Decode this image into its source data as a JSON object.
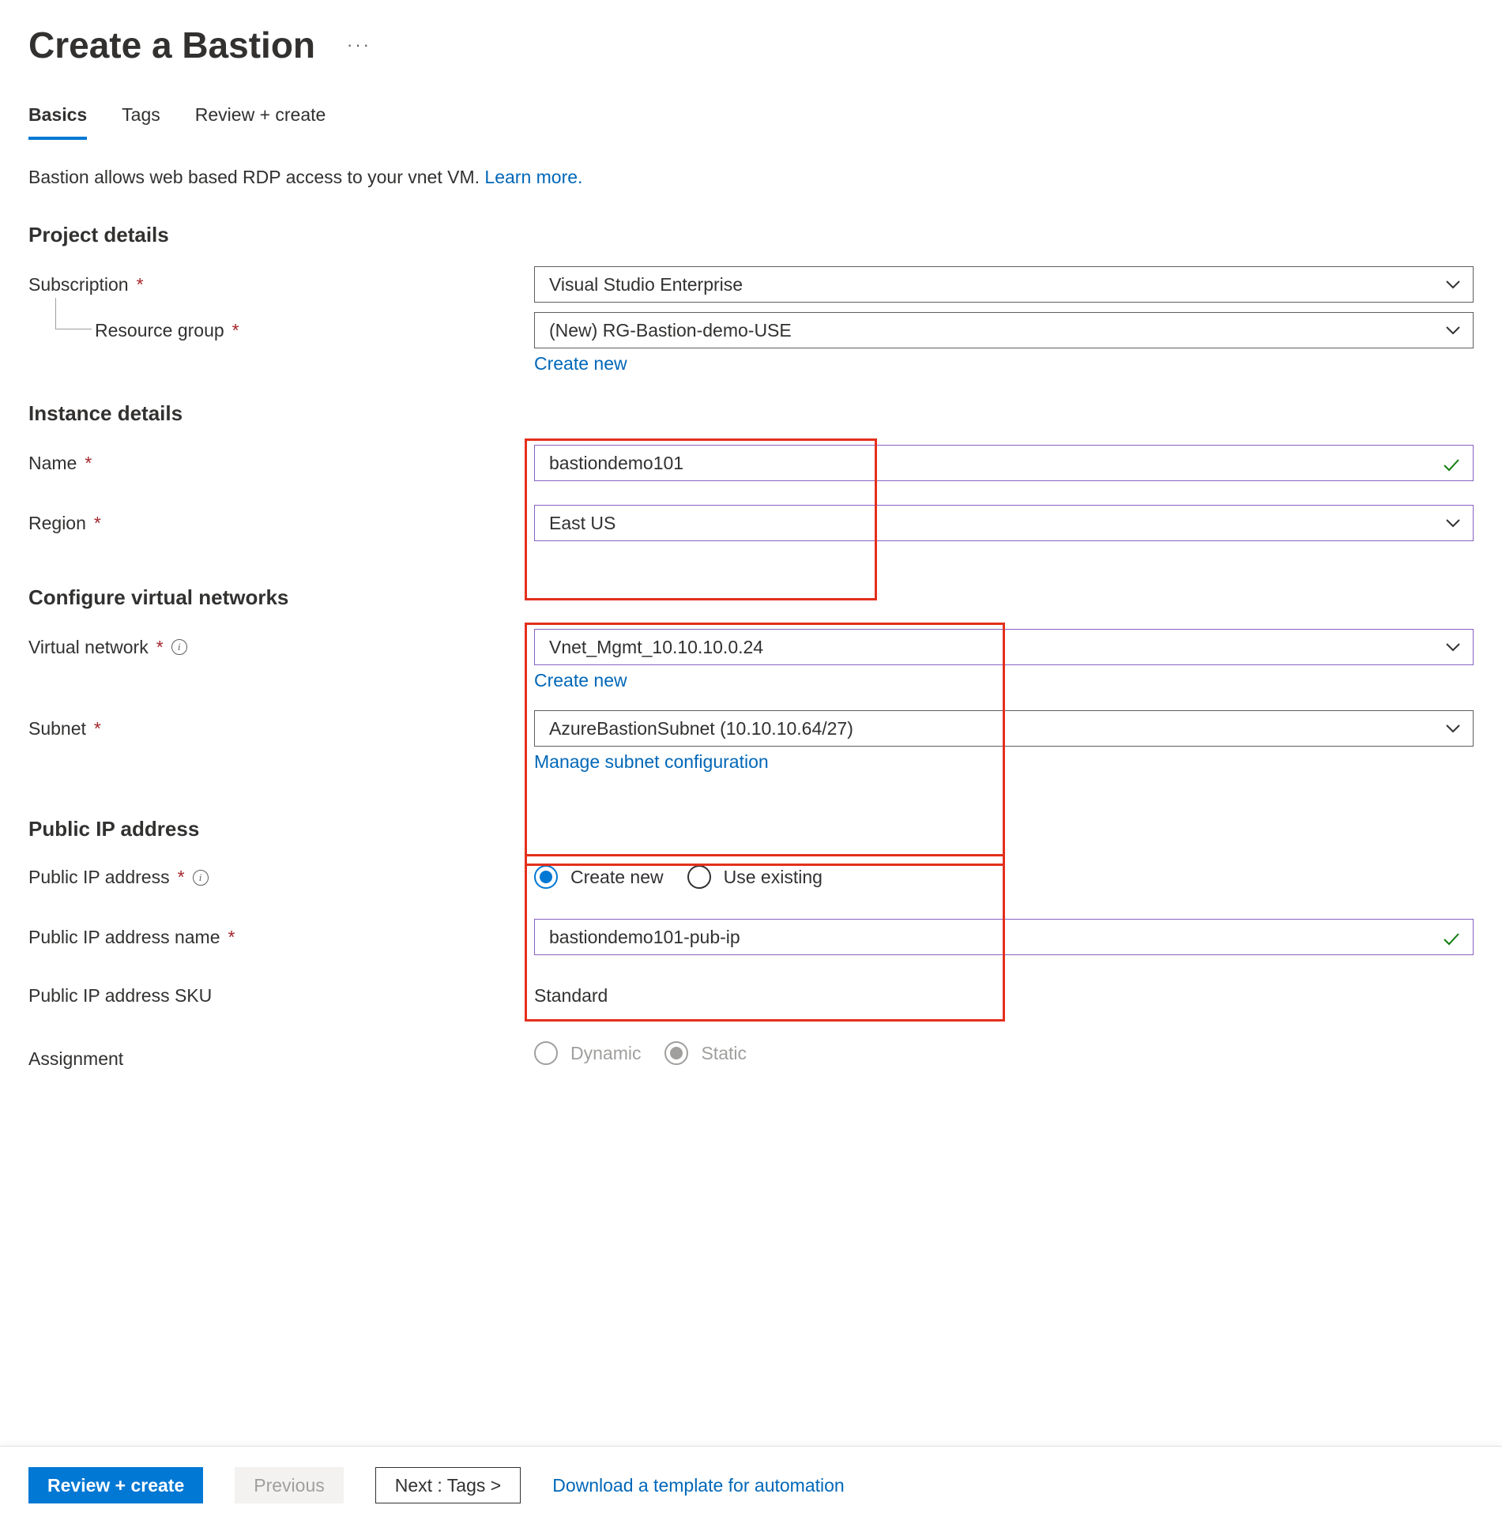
{
  "title": "Create a Bastion",
  "tabs": {
    "basics": "Basics",
    "tags": "Tags",
    "review": "Review + create"
  },
  "intro": {
    "text": "Bastion allows web based RDP access to your vnet VM.  ",
    "learn": "Learn more."
  },
  "sections": {
    "project": {
      "title": "Project details",
      "subscription_label": "Subscription",
      "subscription_value": "Visual Studio Enterprise",
      "rg_label": "Resource group",
      "rg_value": "(New) RG-Bastion-demo-USE",
      "create_new": "Create new"
    },
    "instance": {
      "title": "Instance details",
      "name_label": "Name",
      "name_value": "bastiondemo101",
      "region_label": "Region",
      "region_value": "East US"
    },
    "vnet": {
      "title": "Configure virtual networks",
      "vnet_label": "Virtual network",
      "vnet_value": "Vnet_Mgmt_10.10.10.0.24",
      "create_new": "Create new",
      "subnet_label": "Subnet",
      "subnet_value": "AzureBastionSubnet (10.10.10.64/27)",
      "manage": "Manage subnet configuration"
    },
    "pip": {
      "title": "Public IP address",
      "pip_label": "Public IP address",
      "radio_create": "Create new",
      "radio_existing": "Use existing",
      "pip_name_label": "Public IP address name",
      "pip_name_value": "bastiondemo101-pub-ip",
      "sku_label": "Public IP address SKU",
      "sku_value": "Standard",
      "assignment_label": "Assignment",
      "assignment_dynamic": "Dynamic",
      "assignment_static": "Static"
    }
  },
  "footer": {
    "review": "Review + create",
    "previous": "Previous",
    "next": "Next : Tags >",
    "download": "Download a template for automation"
  }
}
